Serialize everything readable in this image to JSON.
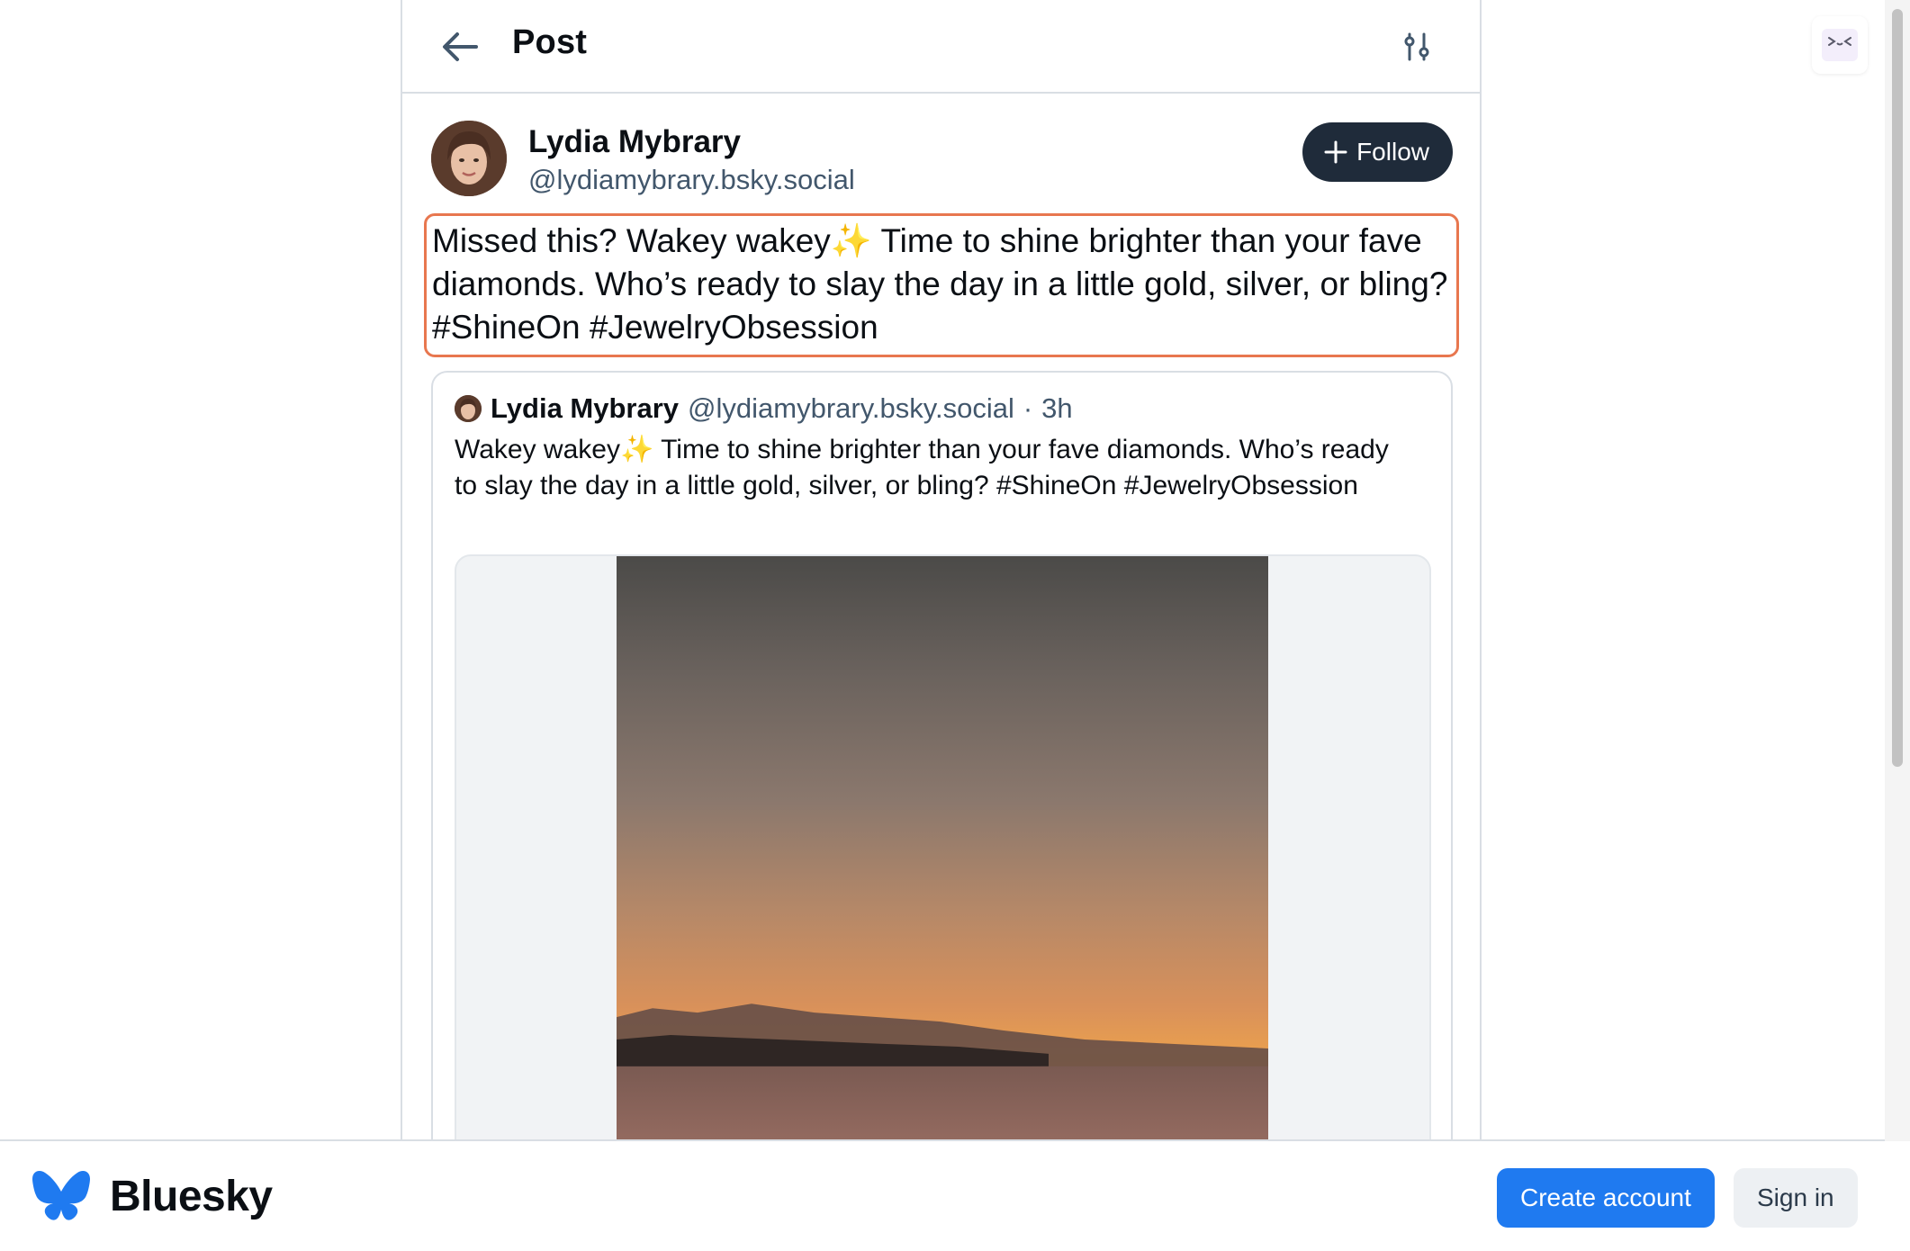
{
  "header": {
    "title": "Post",
    "back_icon": "arrow-left-icon",
    "filter_icon": "sliders-icon"
  },
  "author": {
    "name": "Lydia Mybrary",
    "handle": "@lydiamybrary.bsky.social",
    "follow_label": "Follow"
  },
  "post": {
    "text": "Missed this? Wakey wakey✨ Time to shine brighter than your fave diamonds. Who’s ready to slay the day in a little gold, silver, or bling? #ShineOn #JewelryObsession"
  },
  "quoted_post": {
    "name": "Lydia Mybrary",
    "handle": "@lydiamybrary.bsky.social",
    "separator": "·",
    "time": "3h",
    "text": "Wakey wakey✨ Time to shine brighter than your fave diamonds. Who’s ready to slay the day in a little gold, silver, or bling? #ShineOn #JewelryObsession"
  },
  "footer": {
    "brand": "Bluesky",
    "create_account": "Create account",
    "sign_in": "Sign in"
  },
  "colors": {
    "accent": "#1f7af0",
    "follow_bg": "#1f2b3a",
    "highlight_border": "#e8774f",
    "handle": "#42576c"
  }
}
